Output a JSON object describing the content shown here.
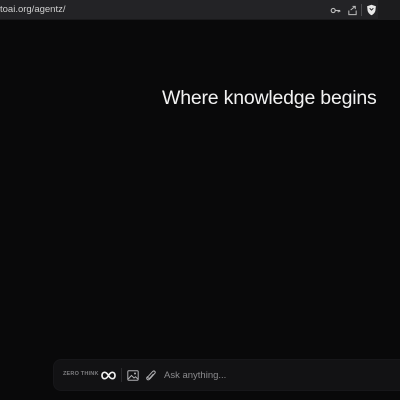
{
  "browser": {
    "url": "toai.org/agentz/",
    "icons": [
      "key-icon",
      "share-icon",
      "brave-shield-icon"
    ]
  },
  "main": {
    "headline": "Where knowledge begins"
  },
  "input_bar": {
    "mode_label": "ZERO THINK",
    "mode_icon": "infinity-icon",
    "image_icon": "image-icon",
    "attach_icon": "paperclip-icon",
    "placeholder": "Ask anything...",
    "value": ""
  },
  "colors": {
    "background": "#09090a",
    "urlbar": "#232326",
    "headline_text": "#f2f2f2",
    "input_bar": "#121214"
  }
}
